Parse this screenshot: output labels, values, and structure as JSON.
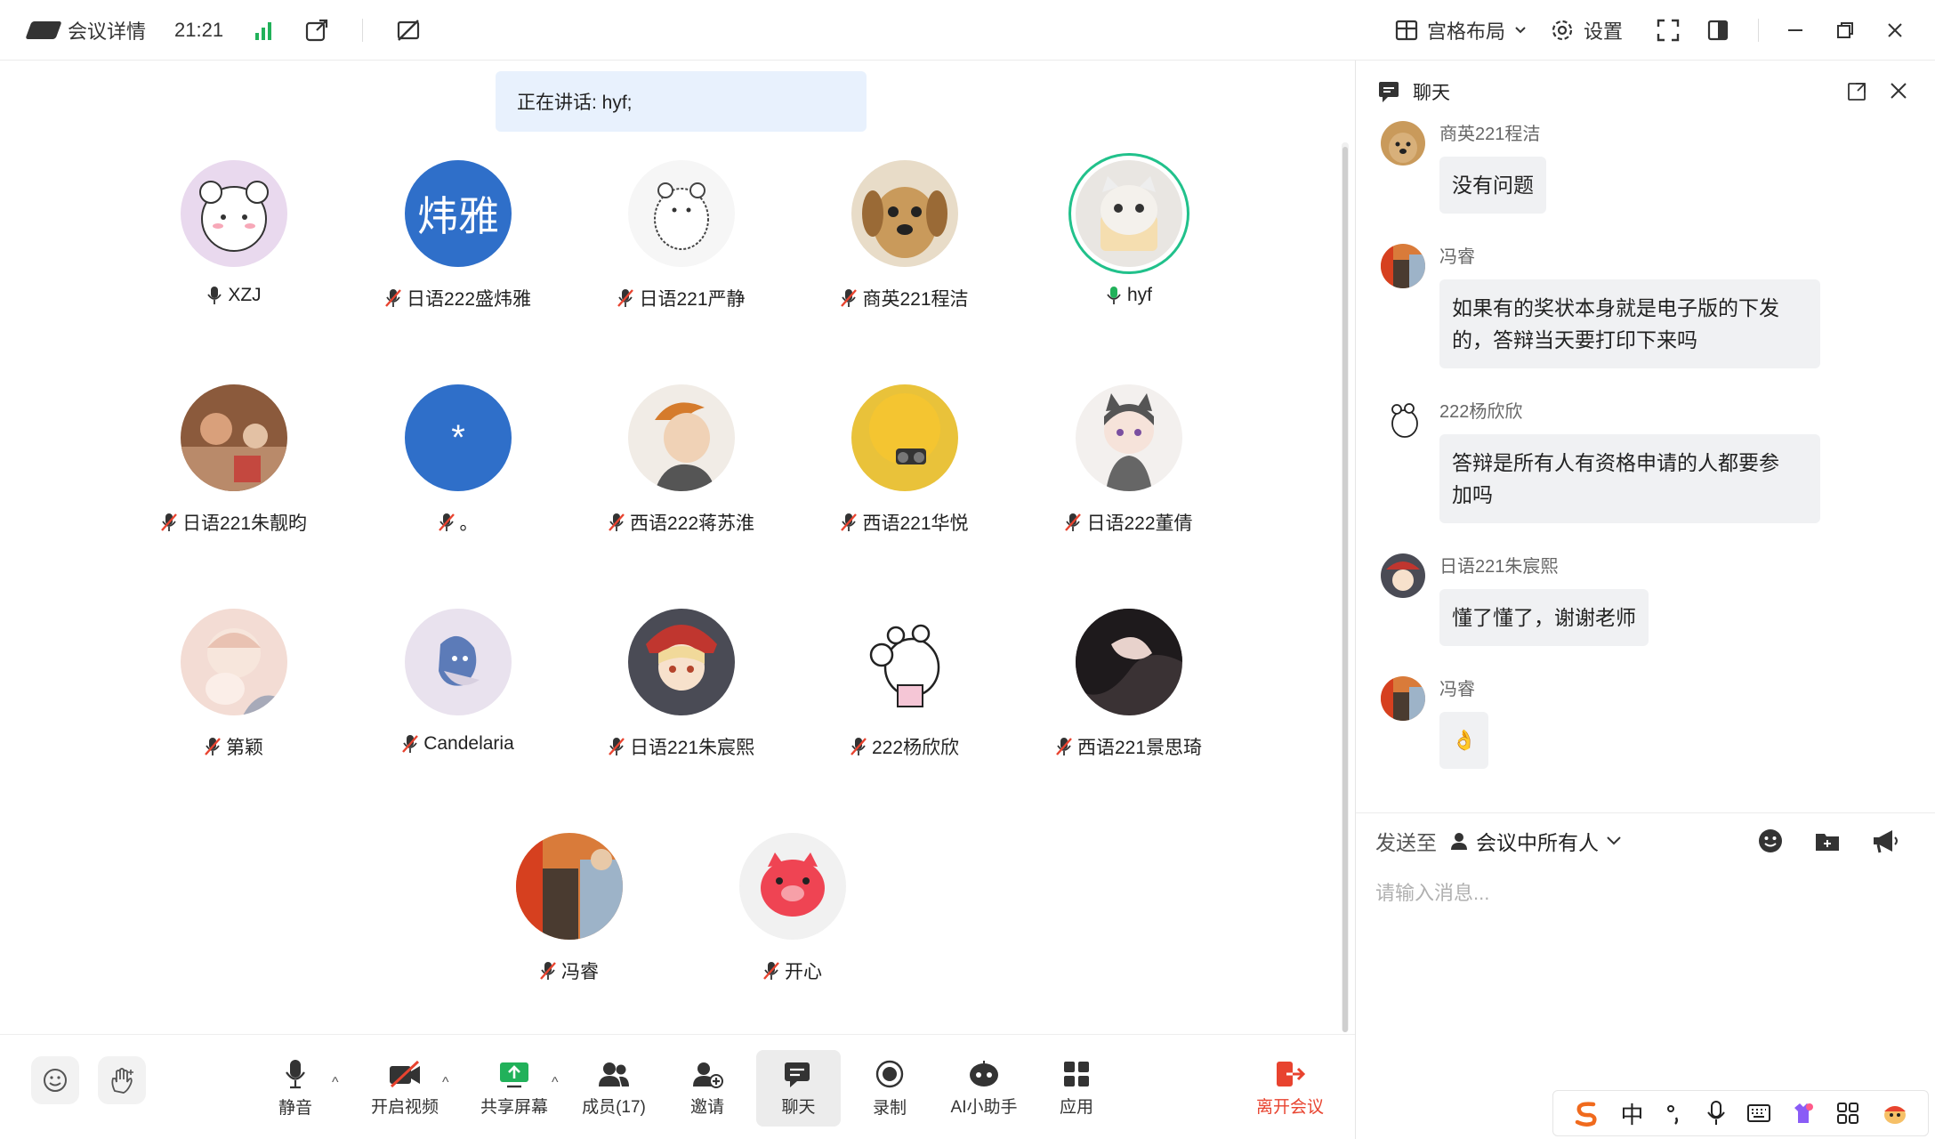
{
  "topbar": {
    "meeting_details": "会议详情",
    "time": "21:21",
    "layout": "宫格布局",
    "settings": "设置"
  },
  "speaking_banner": "正在讲话: hyf;",
  "participants": [
    {
      "name": "XZJ",
      "muted": false
    },
    {
      "name": "日语222盛炜雅",
      "muted": true,
      "initials": "炜雅"
    },
    {
      "name": "日语221严静",
      "muted": true
    },
    {
      "name": "商英221程洁",
      "muted": true
    },
    {
      "name": "hyf",
      "muted": false,
      "speaking": true
    },
    {
      "name": "日语221朱靓昀",
      "muted": true
    },
    {
      "name": "。",
      "muted": true,
      "initials": "*"
    },
    {
      "name": "西语222蒋苏淮",
      "muted": true
    },
    {
      "name": "西语221华悦",
      "muted": true
    },
    {
      "name": "日语222董倩",
      "muted": true
    },
    {
      "name": "第颖",
      "muted": true
    },
    {
      "name": "Candelaria",
      "muted": true
    },
    {
      "name": "日语221朱宸熙",
      "muted": true
    },
    {
      "name": "222杨欣欣",
      "muted": true
    },
    {
      "name": "西语221景思琦",
      "muted": true
    },
    {
      "name": "冯睿",
      "muted": true
    },
    {
      "name": "开心",
      "muted": true
    }
  ],
  "toolbar": {
    "mute": "静音",
    "video": "开启视频",
    "share": "共享屏幕",
    "members": "成员(17)",
    "invite": "邀请",
    "chat": "聊天",
    "record": "录制",
    "ai": "AI小助手",
    "apps": "应用",
    "leave": "离开会议"
  },
  "chat": {
    "title": "聊天",
    "messages": [
      {
        "sender": "商英221程洁",
        "text": "没有问题"
      },
      {
        "sender": "冯睿",
        "text_line1": "如果有的奖状本身就是电子版的下发",
        "text_line2": "的，答辩当天要打印下来吗"
      },
      {
        "sender": "222杨欣欣",
        "text_line1": "答辩是所有人有资格申请的人都要参",
        "text_line2": "加吗"
      },
      {
        "sender": "日语221朱宸熙",
        "text": "懂了懂了，谢谢老师"
      },
      {
        "sender": "冯睿",
        "text": "👌"
      }
    ],
    "send_to_label": "发送至",
    "send_to_target": "会议中所有人",
    "input_placeholder": "请输入消息..."
  },
  "ime": {
    "lang": "中"
  },
  "colors": {
    "accent_blue": "#2f6fc9",
    "speaking_green": "#21c18b",
    "leave_red": "#e8432f",
    "signal_green": "#21b15a"
  }
}
